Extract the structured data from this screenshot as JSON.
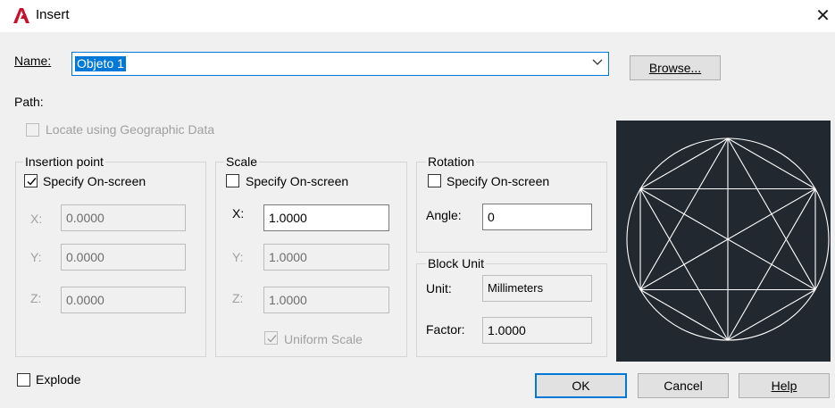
{
  "window": {
    "title": "Insert",
    "close_glyph": "✕",
    "app_icon": "autocad-a-icon"
  },
  "name": {
    "label": "Name:",
    "value": "Objeto 1",
    "browse_label": "Browse..."
  },
  "path": {
    "label": "Path:"
  },
  "geo": {
    "label": "Locate using Geographic Data",
    "checked": false,
    "enabled": false
  },
  "insertion_point": {
    "title": "Insertion point",
    "specify_label": "Specify On-screen",
    "specify_checked": true,
    "x_label": "X:",
    "x_value": "0.0000",
    "y_label": "Y:",
    "y_value": "0.0000",
    "z_label": "Z:",
    "z_value": "0.0000"
  },
  "scale": {
    "title": "Scale",
    "specify_label": "Specify On-screen",
    "specify_checked": false,
    "x_label": "X:",
    "x_value": "1.0000",
    "y_label": "Y:",
    "y_value": "1.0000",
    "z_label": "Z:",
    "z_value": "1.0000",
    "uniform_label": "Uniform Scale",
    "uniform_checked": true
  },
  "rotation": {
    "title": "Rotation",
    "specify_label": "Specify On-screen",
    "specify_checked": false,
    "angle_label": "Angle:",
    "angle_value": "0"
  },
  "block_unit": {
    "title": "Block Unit",
    "unit_label": "Unit:",
    "unit_value": "Millimeters",
    "factor_label": "Factor:",
    "factor_value": "1.0000"
  },
  "explode": {
    "label": "Explode",
    "checked": false
  },
  "buttons": {
    "ok": "OK",
    "cancel": "Cancel",
    "help": "Help"
  },
  "colors": {
    "accent": "#0078d7",
    "dialog_bg": "#f0f0f0",
    "preview_bg": "#212830",
    "preview_stroke": "#ffffff",
    "app_icon_red": "#c8102e"
  }
}
